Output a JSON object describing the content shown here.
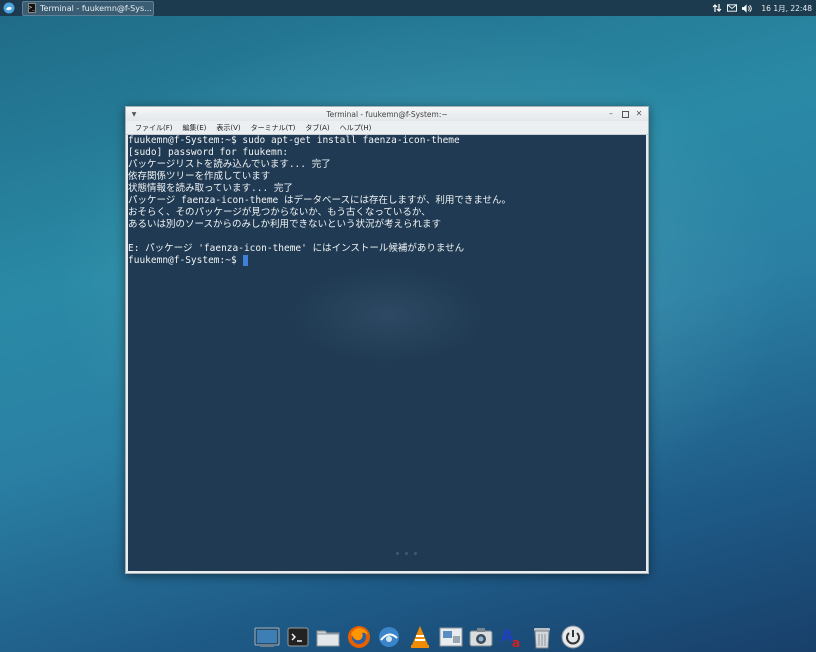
{
  "panel": {
    "task_label": "Terminal - fuukemn@f-Sys...",
    "clock": "16 1月, 22:48"
  },
  "window": {
    "title": "Terminal - fuukemn@f-System:~",
    "menus": [
      "ファイル(F)",
      "編集(E)",
      "表示(V)",
      "ターミナル(T)",
      "タブ(A)",
      "ヘルプ(H)"
    ]
  },
  "terminal": {
    "lines": [
      "fuukemn@f-System:~$ sudo apt-get install faenza-icon-theme",
      "[sudo] password for fuukemn:",
      "パッケージリストを読み込んでいます... 完了",
      "依存関係ツリーを作成しています",
      "状態情報を読み取っています... 完了",
      "パッケージ faenza-icon-theme はデータベースには存在しますが、利用できません。",
      "おそらく、そのパッケージが見つからないか、もう古くなっているか、",
      "あるいは別のソースからのみしか利用できないという状況が考えられます",
      "",
      "E: パッケージ 'faenza-icon-theme' にはインストール候補がありません",
      "fuukemn@f-System:~$ "
    ]
  },
  "dock": {
    "icons": [
      "show-desktop-icon",
      "terminal-icon",
      "file-manager-icon",
      "firefox-icon",
      "network-icon",
      "vlc-icon",
      "image-viewer-icon",
      "screenshot-icon",
      "text-editor-icon",
      "trash-icon",
      "power-icon"
    ]
  },
  "colors": {
    "terminal_bg": "#1f3a52",
    "panel_bg": "#1d3b4e",
    "cursor": "#3f7fd9"
  }
}
